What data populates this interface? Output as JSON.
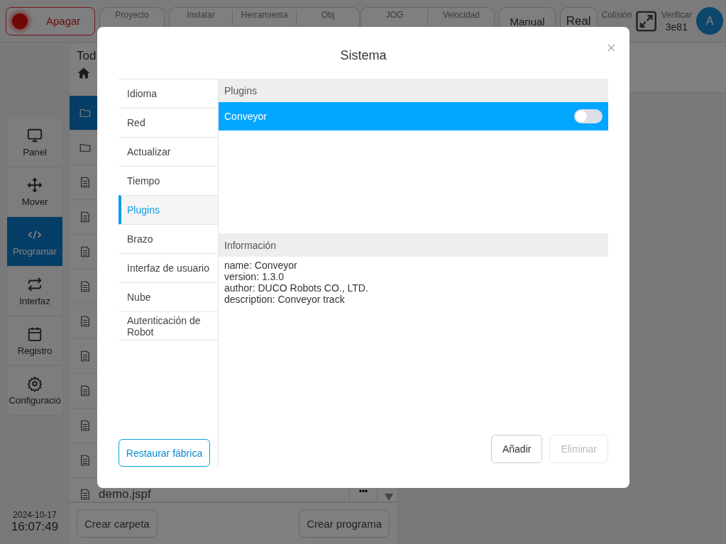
{
  "top_bar": {
    "power": {
      "label": "Apagar"
    },
    "status_groups": [
      [
        {
          "label": "Proyecto"
        }
      ],
      [
        {
          "label": "Instalar"
        },
        {
          "label": "Herramienta"
        },
        {
          "label": "Obj"
        }
      ],
      [
        {
          "label": "JOG"
        },
        {
          "label": "Velocidad"
        }
      ]
    ],
    "mode_buttons": [
      "Manual",
      "Real"
    ],
    "collision": {
      "label": "Colisión"
    },
    "verify": {
      "label": "Verificar",
      "value": "3e81"
    },
    "avatar": "A"
  },
  "nav": [
    {
      "label": "Panel",
      "selected": false
    },
    {
      "label": "Mover",
      "selected": false
    },
    {
      "label": "Programar",
      "selected": true
    },
    {
      "label": "Interfaz",
      "selected": false
    },
    {
      "label": "Registro",
      "selected": false
    },
    {
      "label": "Configuració",
      "selected": false
    }
  ],
  "datetime": {
    "date": "2024-10-17",
    "time": "16:07:49"
  },
  "files": {
    "header": "Tod",
    "rows": [
      {
        "kind": "folder",
        "selected": true
      },
      {
        "kind": "folder",
        "selected": false
      },
      {
        "kind": "file",
        "selected": false
      },
      {
        "kind": "file",
        "selected": false
      },
      {
        "kind": "file",
        "selected": false
      },
      {
        "kind": "file",
        "selected": false
      },
      {
        "kind": "file",
        "selected": false
      },
      {
        "kind": "file",
        "selected": false
      },
      {
        "kind": "file",
        "selected": false
      },
      {
        "kind": "file",
        "selected": false
      },
      {
        "kind": "file",
        "selected": false
      },
      {
        "kind": "file",
        "selected": false,
        "name": "demo.jspf"
      }
    ],
    "more": "•••",
    "buttons": [
      "Crear carpeta",
      "Crear programa"
    ]
  },
  "dialog": {
    "title": "Sistema",
    "menu": [
      {
        "label": "Idioma",
        "selected": false
      },
      {
        "label": "Red",
        "selected": false
      },
      {
        "label": "Actualizar",
        "selected": false
      },
      {
        "label": "Tiempo",
        "selected": false
      },
      {
        "label": "Plugins",
        "selected": true
      },
      {
        "label": "Brazo",
        "selected": false
      },
      {
        "label": "Interfaz de usuario",
        "selected": false
      },
      {
        "label": "Nube",
        "selected": false
      },
      {
        "label": "Autenticación de Robot",
        "selected": false
      }
    ],
    "plugins_header": "Plugins",
    "plugins": [
      {
        "name": "Conveyor",
        "selected": true,
        "on": false
      }
    ],
    "info_header": "Información",
    "info": [
      "name: Conveyor",
      "version: 1.3.0",
      "author: DUCO Robots CO., LTD.",
      "description: Conveyor track"
    ],
    "restore_button": "Restaurar fábrica",
    "actions": [
      {
        "label": "Añadir",
        "disabled": false
      },
      {
        "label": "Eliminar",
        "disabled": true
      }
    ]
  }
}
